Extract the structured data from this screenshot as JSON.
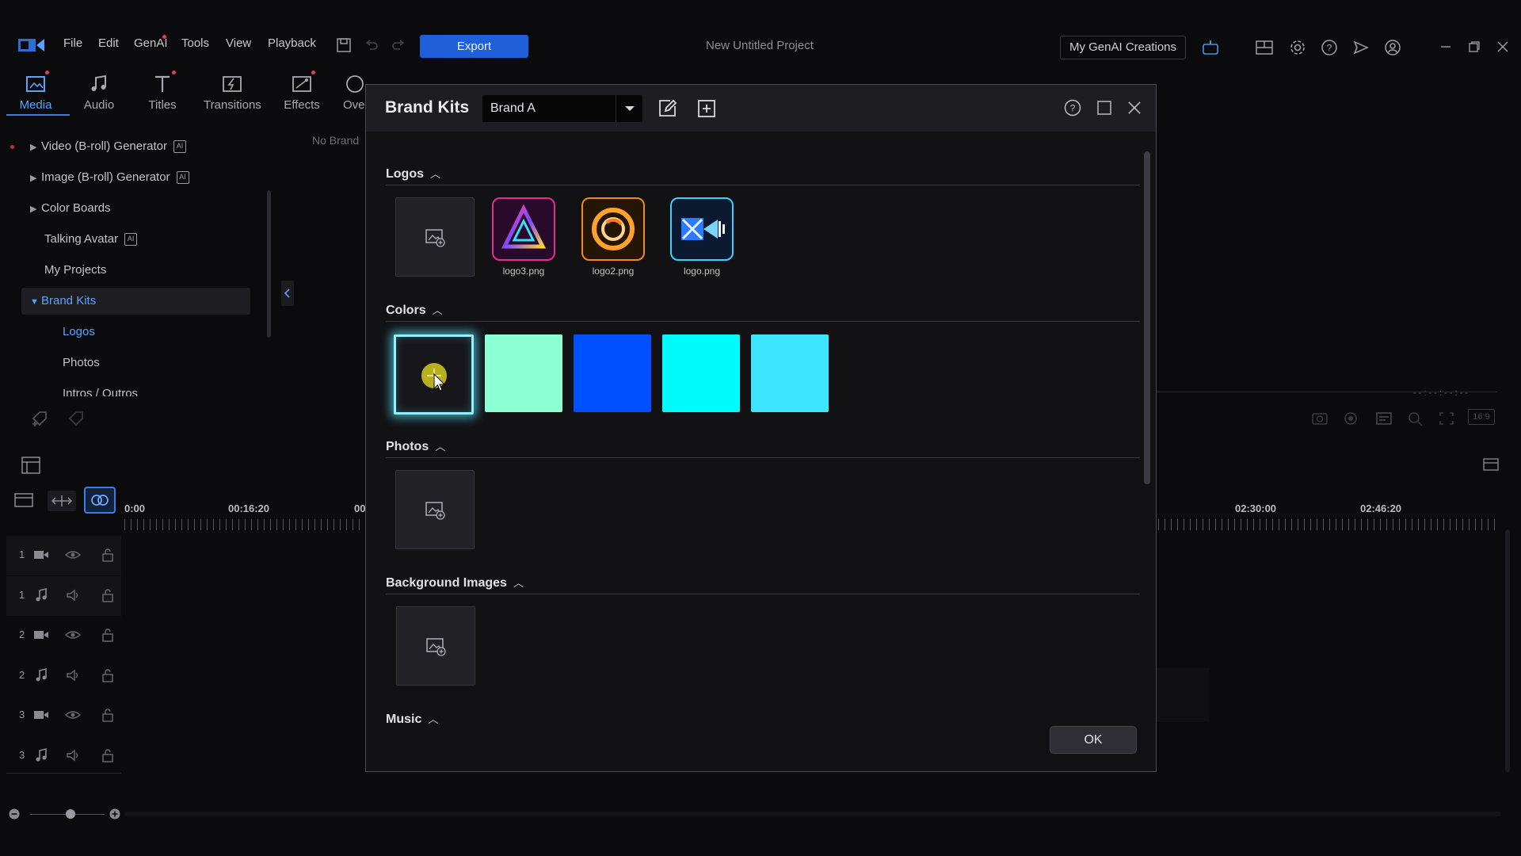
{
  "menubar": {
    "items": [
      "File",
      "Edit",
      "GenAI",
      "Tools",
      "View",
      "Playback"
    ],
    "export_label": "Export",
    "project_title": "New Untitled Project",
    "genai_creations_label": "My GenAI Creations"
  },
  "rooms": {
    "tabs": [
      {
        "label": "Media",
        "icon": "media-icon",
        "active": true
      },
      {
        "label": "Audio",
        "icon": "music-note-icon"
      },
      {
        "label": "Titles",
        "icon": "title-t-icon"
      },
      {
        "label": "Transitions",
        "icon": "transition-icon"
      },
      {
        "label": "Effects",
        "icon": "effects-icon"
      },
      {
        "label": "Ove",
        "icon": "overlay-icon"
      }
    ]
  },
  "library": {
    "items": [
      {
        "label": "Video (B-roll) Generator",
        "ai": true
      },
      {
        "label": "Image (B-roll) Generator",
        "ai": true
      },
      {
        "label": "Color Boards"
      },
      {
        "label": "Talking Avatar",
        "ai": true
      },
      {
        "label": "My Projects"
      },
      {
        "label": "Brand Kits"
      },
      {
        "label": "Logos"
      },
      {
        "label": "Photos"
      },
      {
        "label": "Intros / Outros"
      }
    ],
    "content_placeholder": "No Brand"
  },
  "timeline": {
    "ruler_labels": [
      "0:00",
      "00:16:20",
      "00",
      "02:30:00",
      "02:46:20"
    ],
    "tracks": [
      "1",
      "1",
      "2",
      "2",
      "3",
      "3"
    ],
    "aspect_ratio": "16:9"
  },
  "dialog": {
    "title": "Brand Kits",
    "selected_kit": "Brand A",
    "sections": {
      "logos": "Logos",
      "colors": "Colors",
      "photos": "Photos",
      "background_images": "Background Images",
      "music": "Music"
    },
    "logos": [
      {
        "name": "logo3.png"
      },
      {
        "name": "logo2.png"
      },
      {
        "name": "logo.png"
      }
    ],
    "colors": [
      "#8cffd4",
      "#0050ff",
      "#00fbff",
      "#3ce6ff"
    ],
    "ok_label": "OK"
  }
}
